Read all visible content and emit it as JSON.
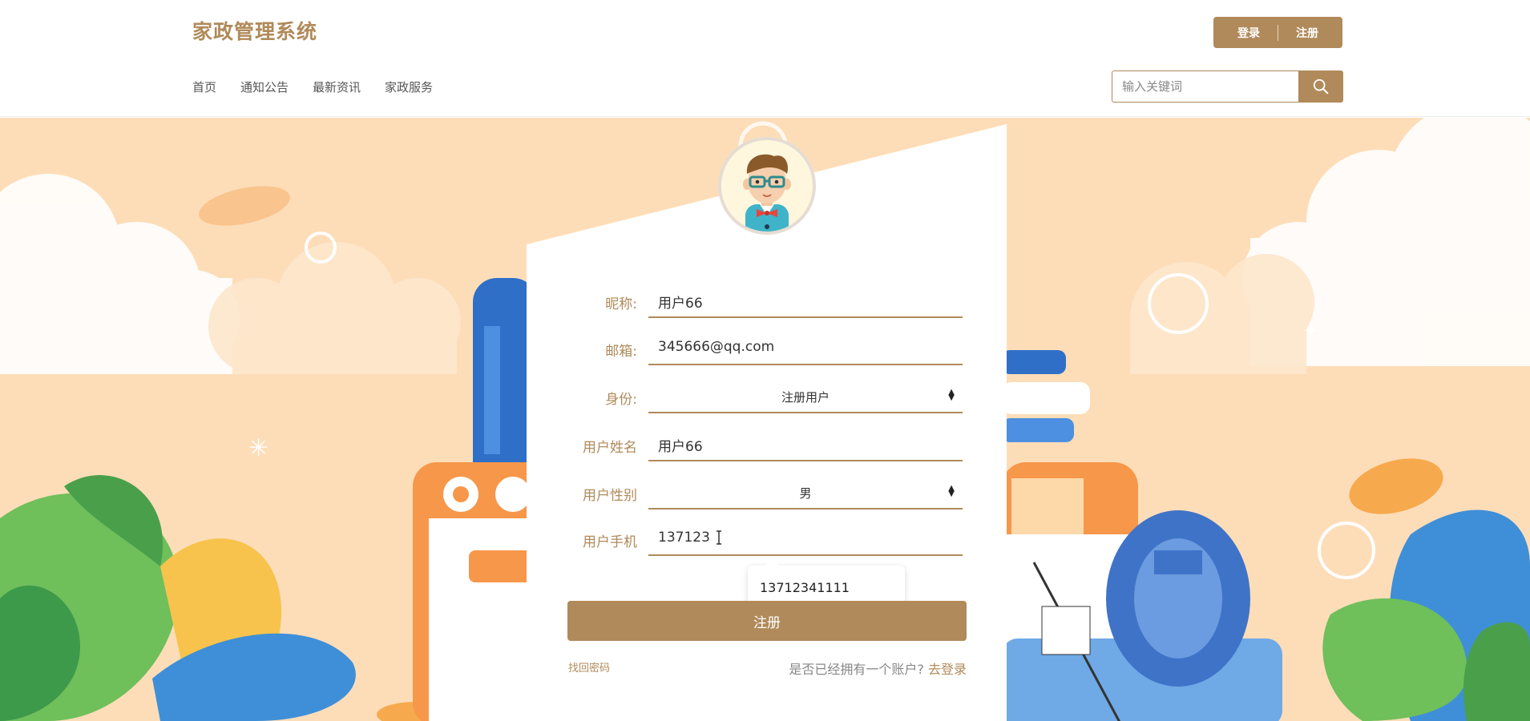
{
  "header": {
    "logo": "家政管理系统",
    "login_label": "登录",
    "register_label": "注册",
    "nav": [
      "首页",
      "通知公告",
      "最新资讯",
      "家政服务"
    ],
    "search_placeholder": "输入关键词"
  },
  "form": {
    "nickname_label": "昵称:",
    "nickname_value": "用户66",
    "email_label": "邮箱:",
    "email_value": "345666@qq.com",
    "role_label": "身份:",
    "role_value": "注册用户",
    "username_label": "用户姓名",
    "username_value": "用户66",
    "gender_label": "用户性别",
    "gender_value": "男",
    "phone_label": "用户手机",
    "phone_value": "137123",
    "autocomplete_suggestion": "13712341111",
    "submit_label": "注册",
    "forgot_label": "找回密码",
    "have_account_text": "是否已经拥有一个账户?",
    "go_login_label": "去登录"
  },
  "colors": {
    "brand": "#b08a5a",
    "background": "#fdddb8"
  }
}
